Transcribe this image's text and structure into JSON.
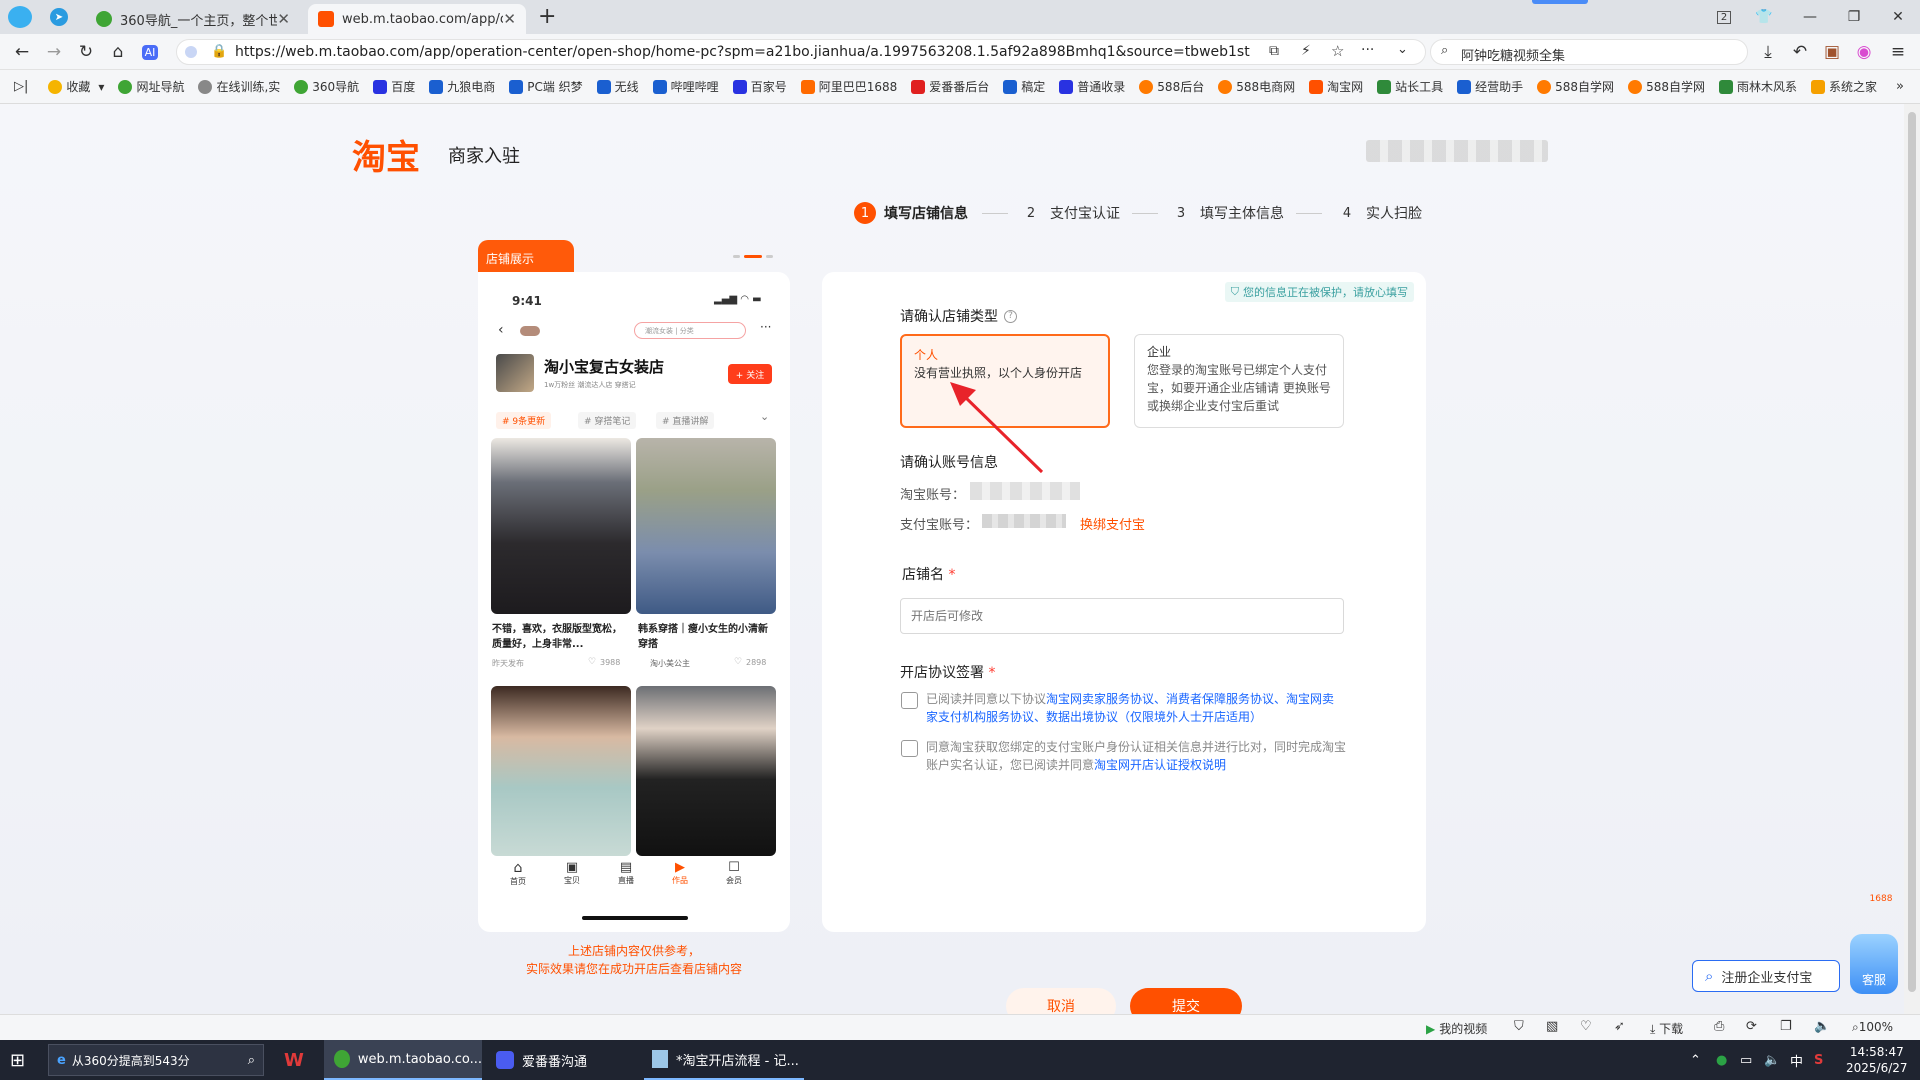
{
  "browser": {
    "tabs": [
      {
        "title": "360导航_一个主页，整个世界",
        "active": false
      },
      {
        "title": "web.m.taobao.com/app/op",
        "active": true
      }
    ],
    "tab_count_badge": "2",
    "url": "https://web.m.taobao.com/app/operation-center/open-shop/home-pc?spm=a21bo.jianhua/a.1997563208.1.5af92a898Bmhq1&source=tbweb1st",
    "search_placeholder": "阿钟吃糖视频全集",
    "bookmarks": [
      "收藏",
      "网址导航",
      "在线训练,实",
      "360导航",
      "百度",
      "九狼电商",
      "PC端 织梦",
      "无线",
      "哔哩哔哩",
      "百家号",
      "阿里巴巴1688",
      "爱番番后台",
      "稿定",
      "普通收录",
      "588后台",
      "588电商网",
      "淘宝网",
      "站长工具",
      "经营助手",
      "588自学网",
      "588自学网",
      "雨林木风系",
      "系统之家"
    ]
  },
  "header": {
    "logo": "淘宝",
    "title": "商家入驻"
  },
  "steps": [
    {
      "num": "1",
      "label": "填写店铺信息",
      "active": true
    },
    {
      "num": "2",
      "label": "支付宝认证",
      "active": false
    },
    {
      "num": "3",
      "label": "填写主体信息",
      "active": false
    },
    {
      "num": "4",
      "label": "实人扫脸",
      "active": false
    }
  ],
  "preview": {
    "badge": "店铺展示",
    "time": "9:41",
    "search_hint": "潮流女装 | 分类",
    "shop_name": "淘小宝复古女装店",
    "shop_meta": "1w万粉丝  潮流达人店  穿搭记",
    "follow": "+ 关注",
    "tags": [
      "# 9条更新",
      "# 穿搭笔记",
      "# 直播讲解"
    ],
    "items": [
      {
        "caption": "不错，喜欢，衣服版型宽松，质量好，上身非常...",
        "time": "昨天发布",
        "likes": "3988"
      },
      {
        "caption": "韩系穿搭｜瘦小女生的小清新穿搭",
        "time": "淘小美公主",
        "likes": "2898"
      }
    ],
    "tabbar": [
      "首页",
      "宝贝",
      "直播",
      "作品",
      "会员"
    ],
    "note_line1": "上述店铺内容仅供参考，",
    "note_line2": "实际效果请您在成功开店后查看店铺内容"
  },
  "form": {
    "protect_notice": "您的信息正在被保护，请放心填写",
    "shop_type_label": "请确认店铺类型",
    "types": [
      {
        "title": "个人",
        "desc": "没有营业执照，以个人身份开店",
        "selected": true
      },
      {
        "title": "企业",
        "desc": "您登录的淘宝账号已绑定个人支付宝，如要开通企业店铺请 更换账号或换绑企业支付宝后重试",
        "selected": false
      }
    ],
    "account_label": "请确认账号信息",
    "taobao_account_label": "淘宝账号：",
    "alipay_account_label": "支付宝账号：",
    "rebind_link": "换绑支付宝",
    "shop_name_label": "店铺名",
    "required_mark": "*",
    "shop_name_placeholder": "开店后可修改",
    "agreement_label": "开店协议签署",
    "agreement1_prefix": "已阅读并同意以下协议",
    "agreement1_links": "淘宝网卖家服务协议、消费者保障服务协议、淘宝网卖家支付机构服务协议、数据出境协议（仅限境外人士开店适用）",
    "agreement2_prefix": "同意淘宝获取您绑定的支付宝账户身份认证相关信息并进行比对，同时完成淘宝账户实名认证，您已阅读并同意",
    "agreement2_link": "淘宝网开店认证授权说明",
    "cancel": "取消",
    "submit": "提交"
  },
  "floating": {
    "service": "客服",
    "register_alipay": "注册企业支付宝",
    "badge": "1688"
  },
  "statusbar": {
    "my_video": "我的视频",
    "download": "下载",
    "zoom": "100%"
  },
  "taskbar": {
    "search_text": "从360分提高到543分",
    "apps": [
      "web.m.taobao.co...",
      "爱番番沟通",
      "*淘宝开店流程 - 记..."
    ],
    "ime": "中",
    "time": "14:58:47",
    "date": "2025/6/27"
  },
  "colors": {
    "brand": "#ff5000",
    "accent": "#ff6a1a",
    "link": "#1a66ff"
  }
}
